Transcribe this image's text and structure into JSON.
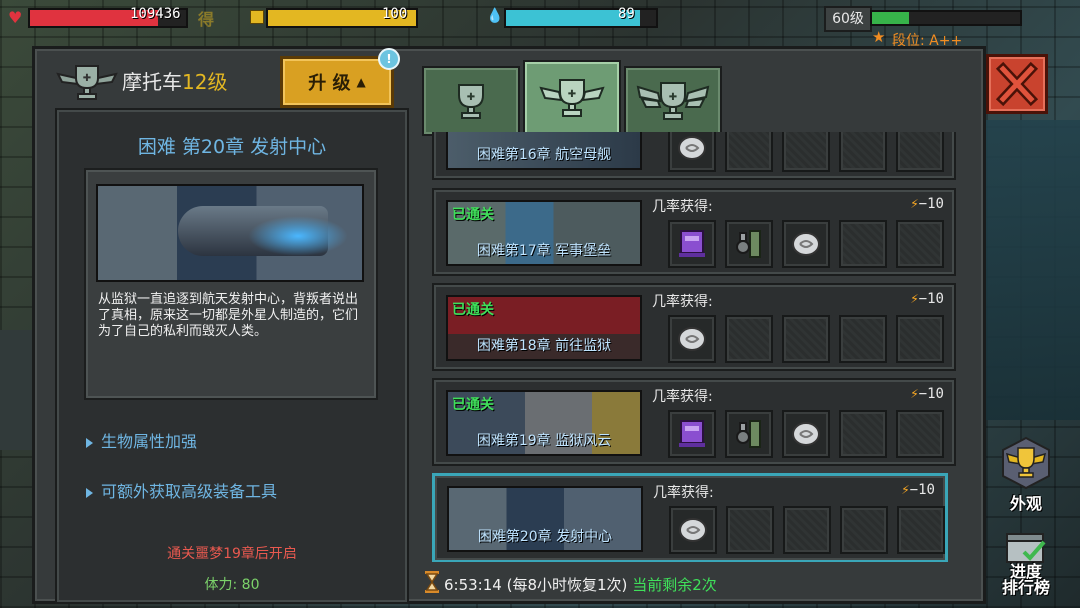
{
  "hud": {
    "hp_value": "109436",
    "hp_fraction": 0.82,
    "get_label": "得",
    "gold_value": "100",
    "gold_fraction": 1.0,
    "water_value": "89",
    "water_fraction": 0.89,
    "player_level": "60级",
    "exp_fraction": 0.25,
    "rank_label": "段位: A++",
    "colors": {
      "hp": "#e0333f",
      "gold": "#e3b722",
      "water": "#3cc2d4",
      "exp": "#37b34a"
    }
  },
  "vehicle": {
    "name": "摩托车",
    "level": "12级",
    "upgrade_label": "升 级",
    "upgrade_badge": "!"
  },
  "selected_stage": {
    "title": "困难 第20章 发射中心",
    "description": "从监狱一直追逐到航天发射中心，背叛者说出了真相，原来这一切都是外星人制造的，它们为了自己的私利而毁灭人类。",
    "bonuses": [
      "生物属性加强",
      "可额外获取高级装备工具"
    ],
    "unlock_hint": "通关噩梦19章后开启",
    "stamina_label": "体力: 80"
  },
  "stages": [
    {
      "caption": "困难第16章 航空母舰",
      "cleared": "",
      "chance_label": "",
      "cost": "",
      "partial": true,
      "items": [
        "coin",
        "empty",
        "empty",
        "empty",
        "empty"
      ]
    },
    {
      "caption": "困难第17章 军事堡垒",
      "cleared": "已通关",
      "chance_label": "几率获得:",
      "cost": "−10",
      "items": [
        "armor",
        "tool",
        "coin",
        "empty",
        "empty"
      ]
    },
    {
      "caption": "困难第18章 前往监狱",
      "cleared": "已通关",
      "chance_label": "几率获得:",
      "cost": "−10",
      "items": [
        "coin",
        "empty",
        "empty",
        "empty",
        "empty"
      ]
    },
    {
      "caption": "困难第19章 监狱风云",
      "cleared": "已通关",
      "chance_label": "几率获得:",
      "cost": "−10",
      "items": [
        "armor",
        "tool",
        "coin",
        "empty",
        "empty"
      ]
    },
    {
      "caption": "困难第20章 发射中心",
      "cleared": "",
      "chance_label": "几率获得:",
      "cost": "−10",
      "items": [
        "coin",
        "empty",
        "empty",
        "empty",
        "empty"
      ],
      "selected": true
    }
  ],
  "footer": {
    "timer": "6:53:14",
    "recover_text": "(每8小时恢复1次)",
    "remaining_text": "当前剩余2次"
  },
  "side": {
    "appearance_label": "外观",
    "leaderboard_label": "进度\n排行榜"
  },
  "icons": {
    "close": "close-icon",
    "trophy": "trophy-icon",
    "bolt": "lightning-icon",
    "hourglass": "hourglass-icon"
  }
}
